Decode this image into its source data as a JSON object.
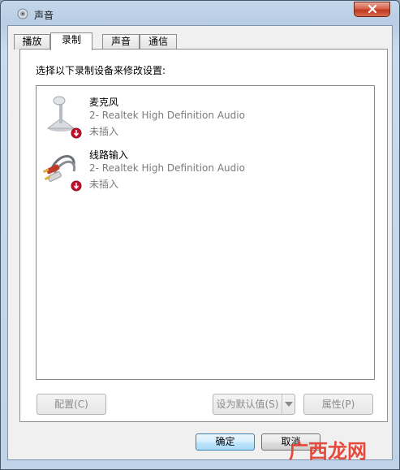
{
  "window": {
    "title": "声音",
    "icon": "speaker-icon",
    "close_icon": "close-icon"
  },
  "tabs": [
    {
      "label": "播放",
      "active": false
    },
    {
      "label": "录制",
      "active": true
    },
    {
      "label": "声音",
      "active": false
    },
    {
      "label": "通信",
      "active": false
    }
  ],
  "recording": {
    "instruction": "选择以下录制设备来修改设置:",
    "devices": [
      {
        "name": "麦克风",
        "description": "2- Realtek High Definition Audio",
        "status": "未插入",
        "icon": "microphone-icon",
        "badge": "disconnected-badge-icon"
      },
      {
        "name": "线路输入",
        "description": "2- Realtek High Definition Audio",
        "status": "未插入",
        "icon": "line-in-cable-icon",
        "badge": "disconnected-badge-icon"
      }
    ]
  },
  "buttons": {
    "configure": "配置(C)",
    "set_default": "设为默认值(S)",
    "properties": "属性(P)",
    "ok": "确定",
    "cancel": "取消"
  },
  "watermark": "广西龙网",
  "colors": {
    "close_red": "#c0391f",
    "status_gray": "#7a7a7a",
    "badge_red": "#c8102e",
    "default_button_border": "#3c7fb1"
  }
}
